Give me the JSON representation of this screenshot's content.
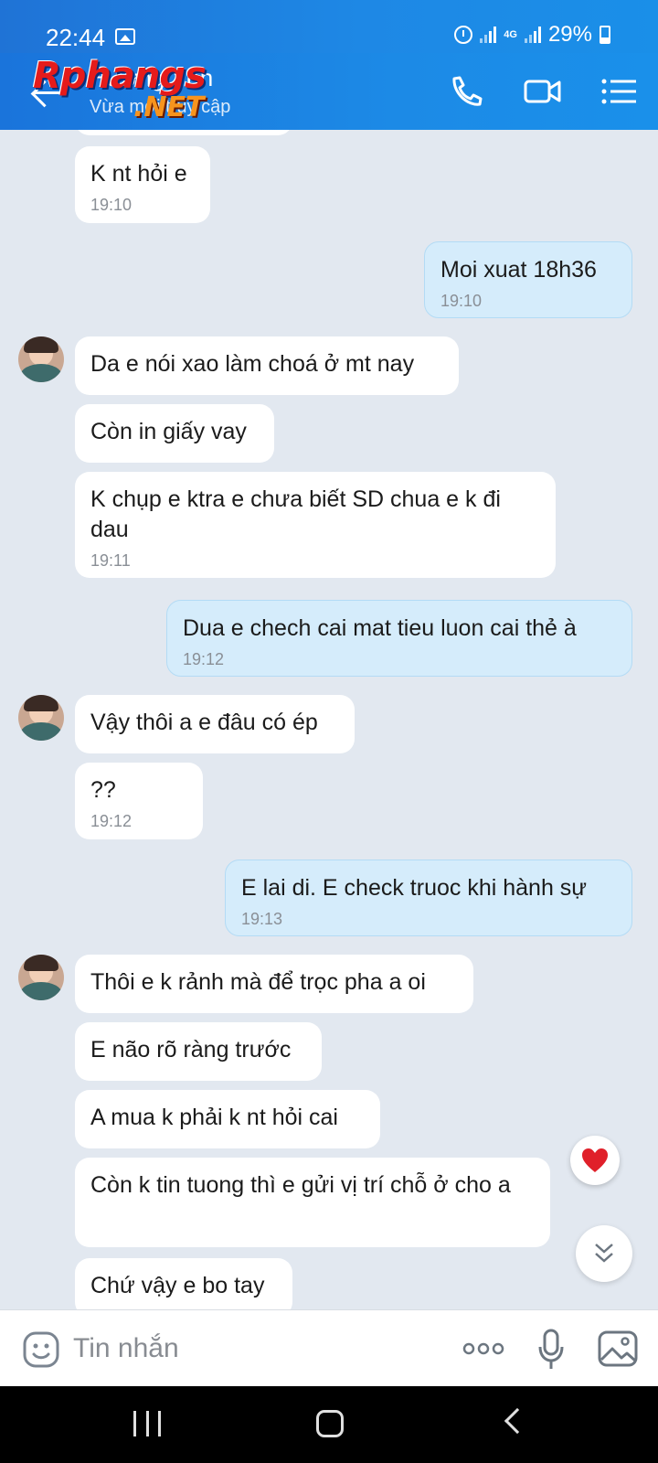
{
  "status_bar": {
    "time": "22:44",
    "network": "4G",
    "battery": "29%"
  },
  "header": {
    "contact_name": "Hương Yến",
    "contact_status": "Vừa mới truy cập",
    "watermark_text": "Rphangs",
    "watermark_suffix": ".NET"
  },
  "messages": [
    {
      "id": "m1",
      "side": "in",
      "text": "K nt hỏi e",
      "time": "19:10"
    },
    {
      "id": "m2",
      "side": "out",
      "text": "Moi xuat 18h36",
      "time": "19:10"
    },
    {
      "id": "m3",
      "side": "in",
      "text": "Da e nói xao làm choá ở mt nay"
    },
    {
      "id": "m4",
      "side": "in",
      "text": "Còn in giấy vay"
    },
    {
      "id": "m5",
      "side": "in",
      "text": "K chụp e ktra e chưa biết SD chua e k đi dau",
      "time": "19:11"
    },
    {
      "id": "m6",
      "side": "out",
      "text": "Dua e chech cai mat tieu luon cai thẻ à",
      "time": "19:12"
    },
    {
      "id": "m7",
      "side": "in",
      "text": "Vậy thôi a e đâu có ép"
    },
    {
      "id": "m8",
      "side": "in",
      "text": "??",
      "time": "19:12"
    },
    {
      "id": "m9",
      "side": "out",
      "text": "E lai di. E check truoc khi hành sự",
      "time": "19:13"
    },
    {
      "id": "m10",
      "side": "in",
      "text": "Thôi e k rảnh mà để trọc pha a oi"
    },
    {
      "id": "m11",
      "side": "in",
      "text": "E não rõ ràng trước"
    },
    {
      "id": "m12",
      "side": "in",
      "text": "A mua k phải k nt hỏi cai"
    },
    {
      "id": "m13",
      "side": "in",
      "text": "Còn k tin tuong thì e gửi vị trí chỗ ở cho a"
    },
    {
      "id": "m14",
      "side": "in",
      "text": "Chứ vậy e bo tay"
    }
  ],
  "composer": {
    "placeholder": "Tin nhắn"
  },
  "icons": {
    "header": [
      "back-arrow-icon",
      "phone-icon",
      "video-call-icon",
      "menu-list-icon"
    ],
    "composer": [
      "sticker-icon",
      "more-icon",
      "microphone-icon",
      "image-icon"
    ],
    "floating": [
      "heart-icon",
      "double-chevron-down-icon"
    ]
  },
  "colors": {
    "header": "#1c84e3",
    "chat_bg": "#e2e8f0",
    "incoming": "#ffffff",
    "outgoing": "#d5ecfb",
    "heart": "#e0202a"
  }
}
